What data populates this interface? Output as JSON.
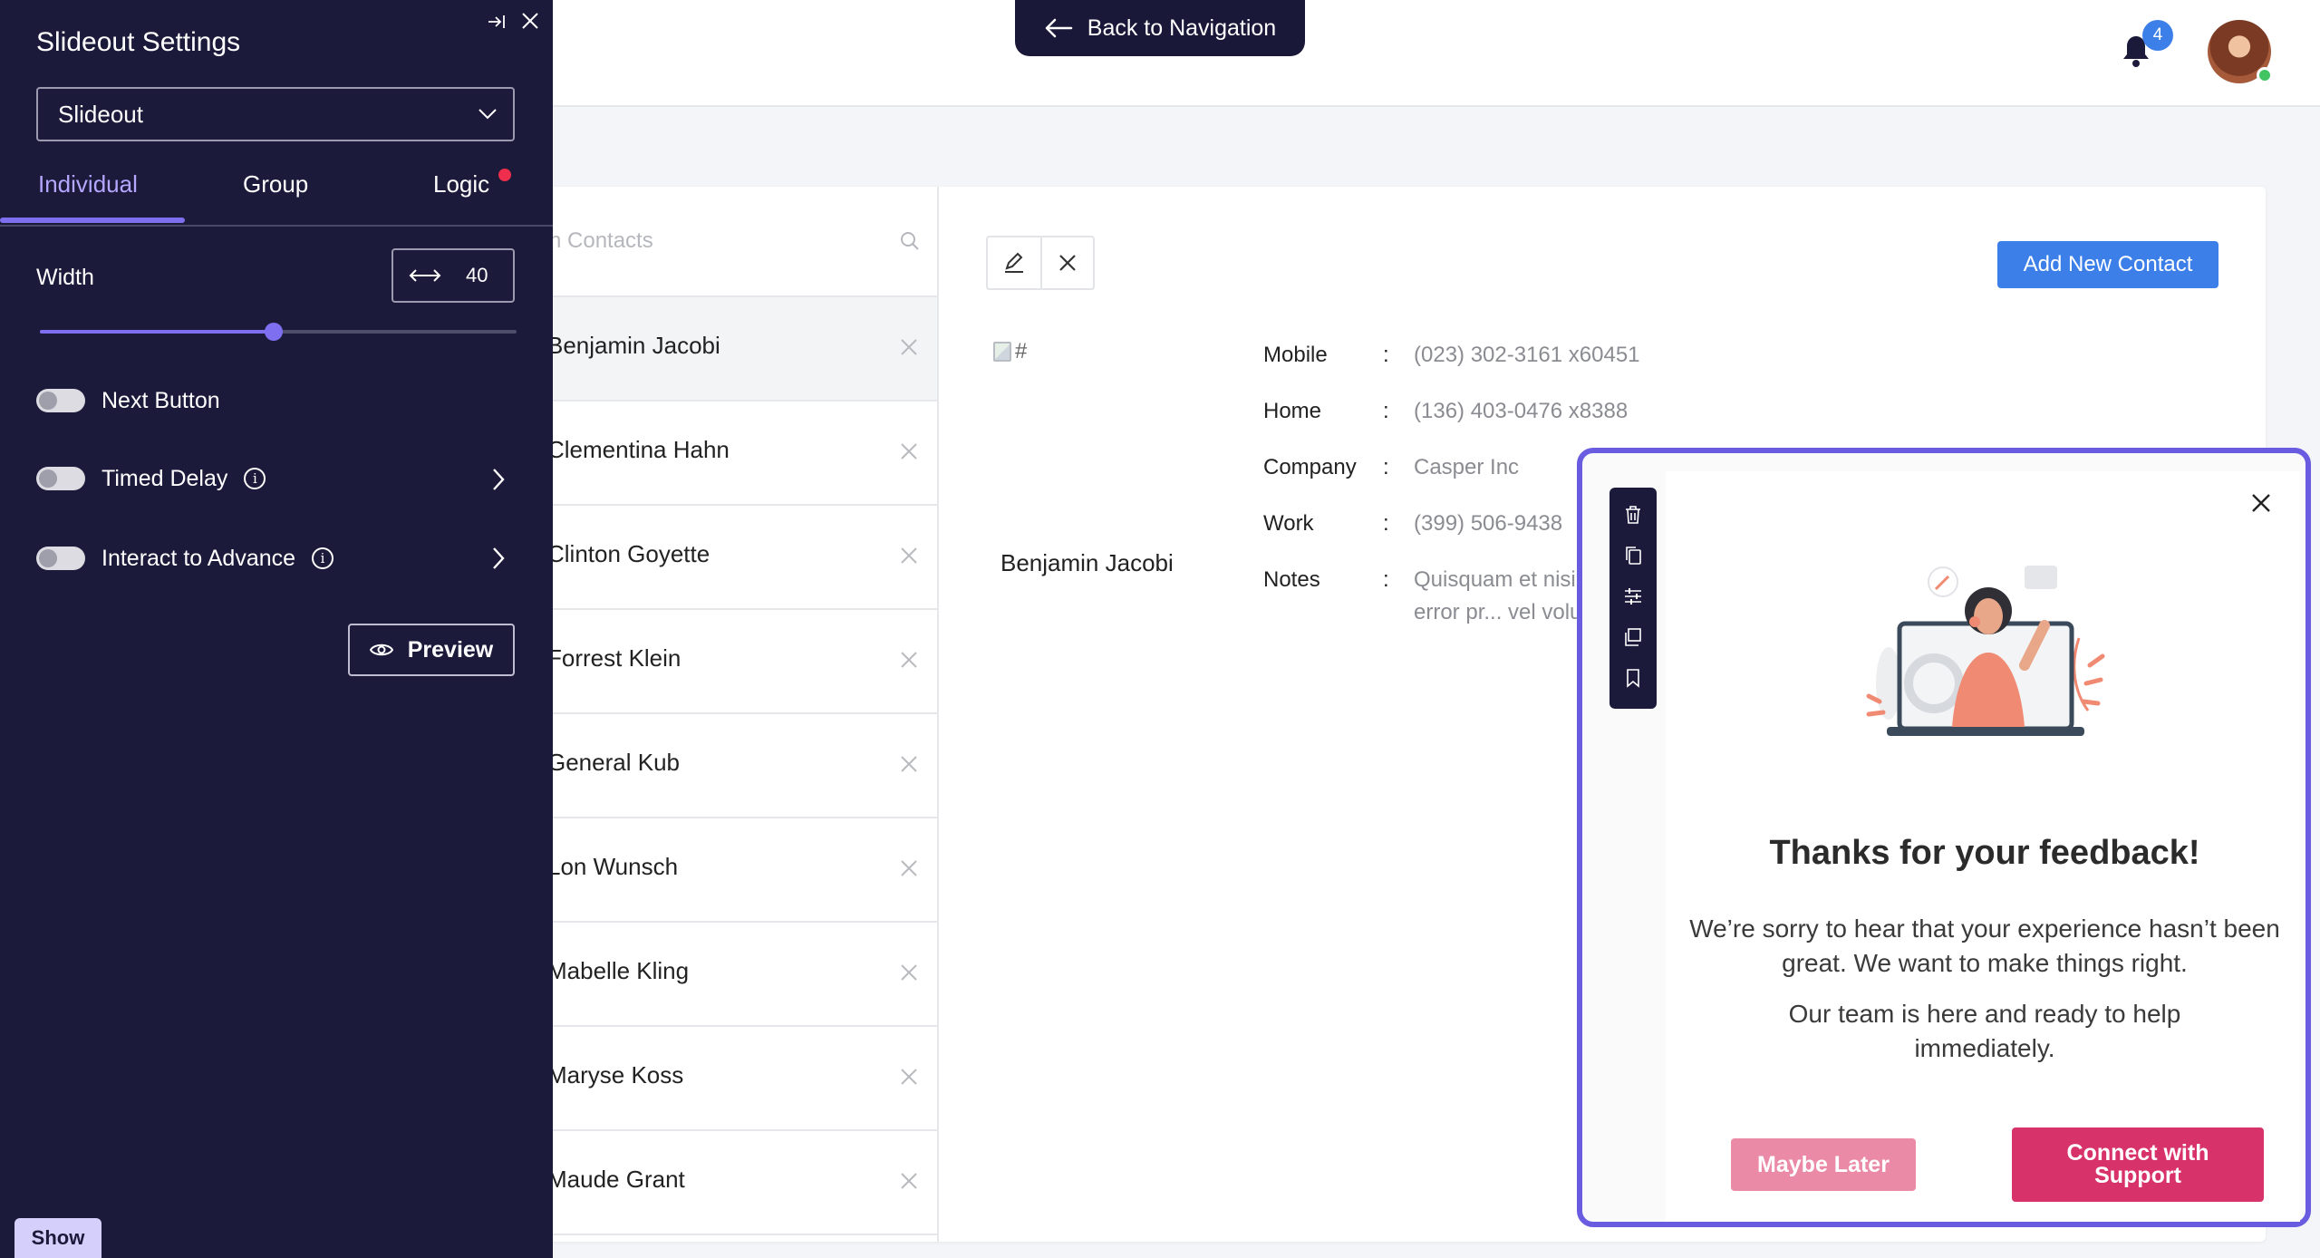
{
  "header": {
    "back_label": "Back to Navigation",
    "notification_count": "4"
  },
  "contacts": {
    "search_placeholder": "n Contacts",
    "list": [
      "Benjamin Jacobi",
      "Clementina Hahn",
      "Clinton Goyette",
      "Forrest Klein",
      "General Kub",
      "Lon Wunsch",
      "Mabelle Kling",
      "Maryse Koss",
      "Maude Grant"
    ],
    "selected_index": 0,
    "add_button": "Add New Contact",
    "detail": {
      "image_alt": "#",
      "name": "Benjamin Jacobi",
      "fields": [
        {
          "label": "Mobile",
          "value": "(023) 302-3161 x60451"
        },
        {
          "label": "Home",
          "value": "(136) 403-0476 x8388"
        },
        {
          "label": "Company",
          "value": "Casper Inc"
        },
        {
          "label": "Work",
          "value": "(399) 506-9438"
        },
        {
          "label": "Notes",
          "value": "Quisquam et nisi Di... doloremque error pr... vel voluptatem offici..."
        }
      ]
    }
  },
  "panel": {
    "title": "Slideout Settings",
    "type_select": "Slideout",
    "tabs": [
      "Individual",
      "Group",
      "Logic"
    ],
    "active_tab": "Individual",
    "width_label": "Width",
    "width_value": "40",
    "width_slider_fraction": 0.49,
    "toggles": [
      {
        "label": "Next Button",
        "on": false,
        "info": false,
        "chevron": false
      },
      {
        "label": "Timed Delay",
        "on": false,
        "info": true,
        "chevron": true
      },
      {
        "label": "Interact to Advance",
        "on": false,
        "info": true,
        "chevron": true
      }
    ],
    "preview_label": "Preview",
    "show_label": "Show"
  },
  "feedback": {
    "title": "Thanks for your feedback!",
    "text1": "We’re sorry to hear that your experience hasn’t been great. We want to make things right.",
    "text2": "Our team is here and ready to help immediately.",
    "later_label": "Maybe Later",
    "connect_label": "Connect with Support",
    "toolbar_icons": [
      "trash-icon",
      "copy-icon",
      "sliders-icon",
      "layers-icon",
      "bookmark-icon"
    ]
  },
  "colors": {
    "panel_bg": "#1b1a3a",
    "accent": "#7d6ff0",
    "primary_blue": "#3d7fe8",
    "cta_pink": "#d8326a",
    "later_pink": "#ea8aa6",
    "frame_purple": "#6a5ce0"
  }
}
